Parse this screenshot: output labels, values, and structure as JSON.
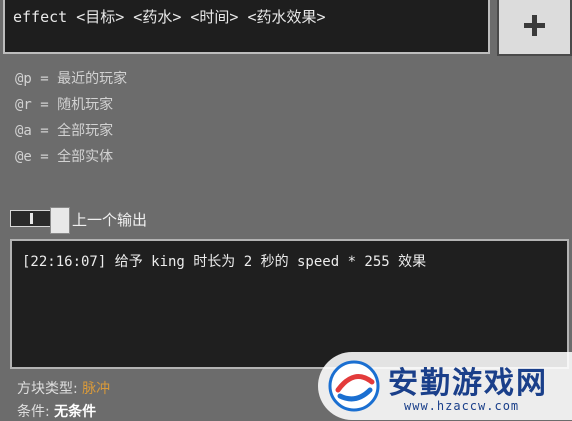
{
  "command": {
    "text": "effect <目标> <药水> <时间> <药水效果>"
  },
  "add_button": {
    "icon": "plus-icon"
  },
  "selectors": [
    "@p = 最近的玩家",
    "@r = 随机玩家",
    "@a = 全部玩家",
    "@e = 全部实体"
  ],
  "previous_output": {
    "label": "上一个输出",
    "text": "[22:16:07] 给予 king 时长为 2 秒的 speed * 255 效果"
  },
  "block_type": {
    "label": "方块类型: ",
    "value": "脉冲",
    "value_color": "#d99a3a"
  },
  "condition": {
    "label": "条件: ",
    "value": "无条件"
  },
  "watermark": {
    "title": "安勤游戏网",
    "url": "www.hzaccw.com"
  }
}
